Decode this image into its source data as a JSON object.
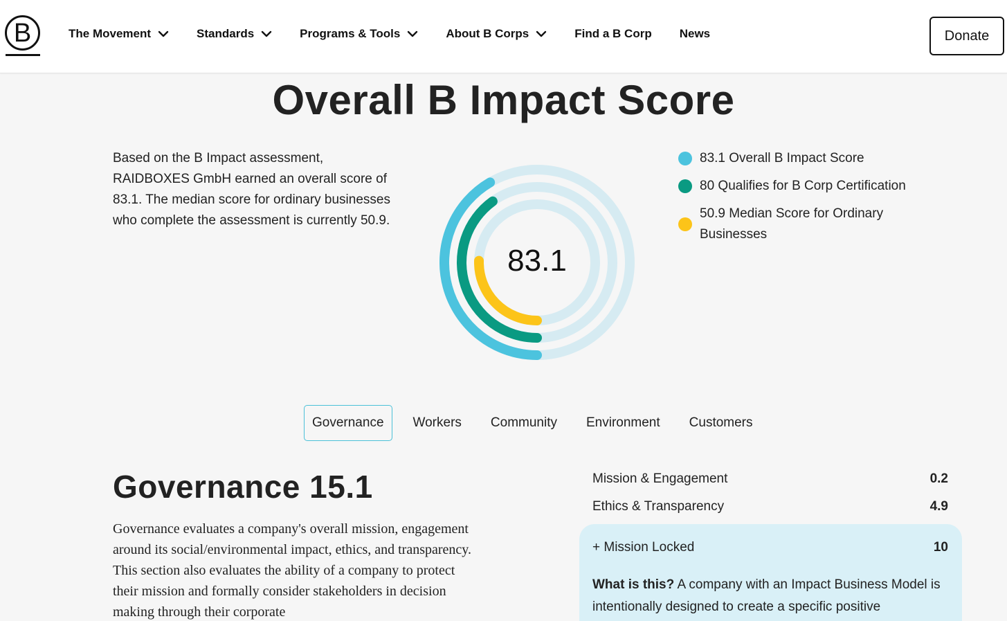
{
  "header": {
    "logo_letter": "B",
    "nav": [
      {
        "label": "The Movement",
        "has_dropdown": true
      },
      {
        "label": "Standards",
        "has_dropdown": true
      },
      {
        "label": "Programs & Tools",
        "has_dropdown": true
      },
      {
        "label": "About B Corps",
        "has_dropdown": true
      },
      {
        "label": "Find a B Corp",
        "has_dropdown": false
      },
      {
        "label": "News",
        "has_dropdown": false
      }
    ],
    "donate_label": "Donate"
  },
  "main": {
    "title": "Overall B Impact Score",
    "intro": "Based on the B Impact assessment, RAIDBOXES GmbH earned an overall score of 83.1. The median score for ordinary businesses who complete the assessment is currently 50.9.",
    "score_center": "83.1",
    "rings": [
      {
        "value": 83.1,
        "color": "#4cc3de"
      },
      {
        "value": 80,
        "color": "#0a9a82"
      },
      {
        "value": 50.9,
        "color": "#fcc419"
      }
    ],
    "ring_track_color": "#d6ebf2",
    "legend": [
      {
        "label": "83.1 Overall B Impact Score",
        "color": "#4cc3de"
      },
      {
        "label": "80 Qualifies for B Corp Certification",
        "color": "#0a9a82"
      },
      {
        "label": "50.9 Median Score for Ordinary Businesses",
        "color": "#fcc419"
      }
    ]
  },
  "tabs": {
    "items": [
      "Governance",
      "Workers",
      "Community",
      "Environment",
      "Customers"
    ],
    "active": "Governance"
  },
  "governance": {
    "title": "Governance 15.1",
    "description": "Governance evaluates a company's overall mission, engagement around its social/environmental impact, ethics, and transparency. This section also evaluates the ability of a company to protect their mission and formally consider stakeholders in decision making through their corporate",
    "rows": [
      {
        "label": "Mission & Engagement",
        "value": "0.2"
      },
      {
        "label": "Ethics & Transparency",
        "value": "4.9"
      }
    ],
    "locked": {
      "label": "+ Mission Locked",
      "value": "10",
      "what_is_this_label": "What is this?",
      "what_is_this_text": "A company with an Impact Business Model is intentionally designed to create a specific positive"
    }
  }
}
